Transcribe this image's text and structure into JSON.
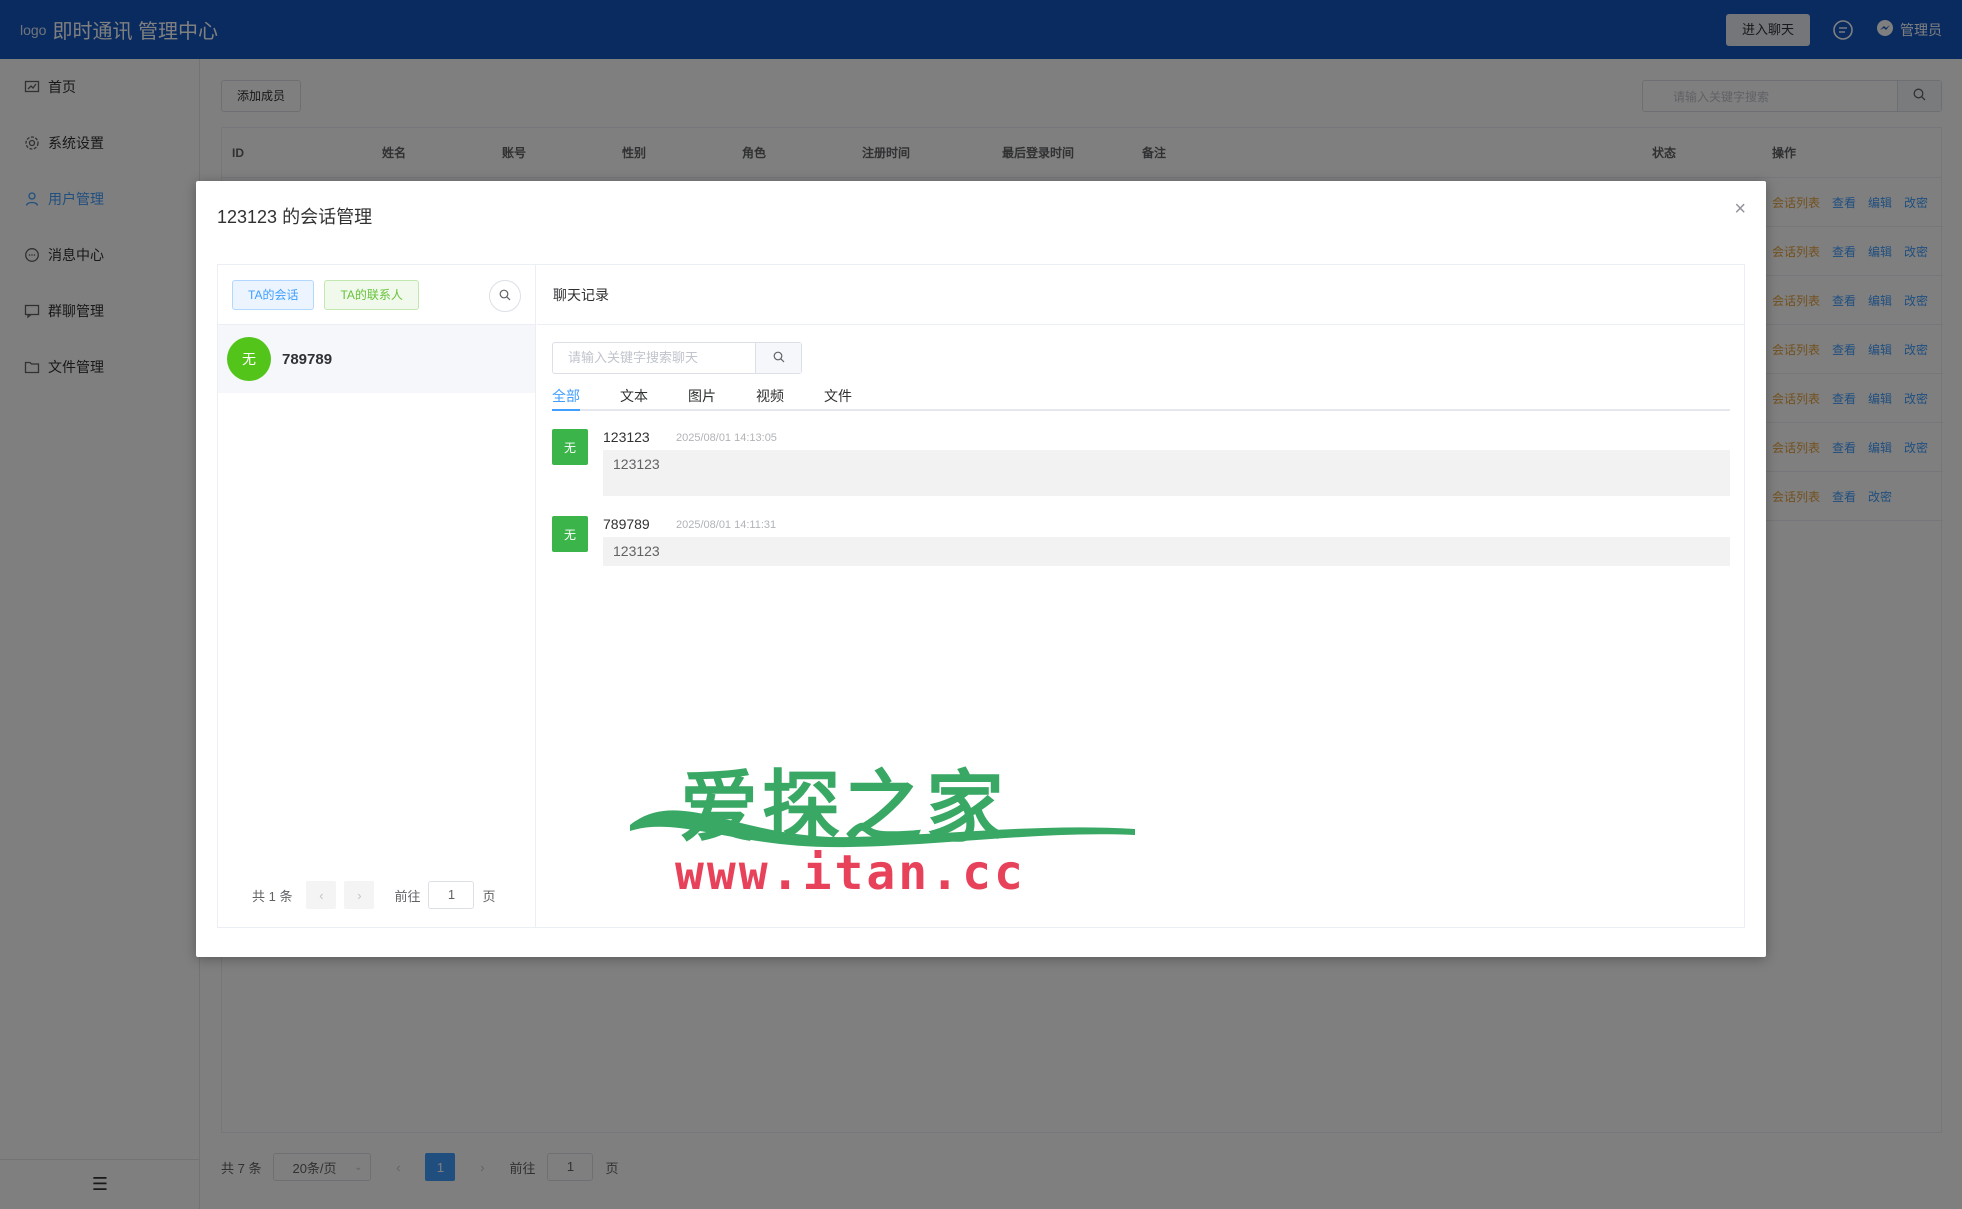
{
  "header": {
    "logo_alt": "logo",
    "title": "即时通讯 管理中心",
    "enter_chat_label": "进入聊天",
    "admin_name": "管理员"
  },
  "sidebar": {
    "items": [
      {
        "label": "首页",
        "icon": "chart-icon"
      },
      {
        "label": "系统设置",
        "icon": "gear-icon"
      },
      {
        "label": "用户管理",
        "icon": "user-icon"
      },
      {
        "label": "消息中心",
        "icon": "message-icon"
      },
      {
        "label": "群聊管理",
        "icon": "group-chat-icon"
      },
      {
        "label": "文件管理",
        "icon": "folder-icon"
      }
    ],
    "active_index": 2
  },
  "main": {
    "add_member_label": "添加成员",
    "search_placeholder": "请输入关键字搜索",
    "columns": [
      "ID",
      "姓名",
      "账号",
      "性别",
      "角色",
      "注册时间",
      "最后登录时间",
      "备注",
      "状态",
      "操作"
    ],
    "row_ops": [
      [
        "会话列表",
        "查看",
        "编辑",
        "改密"
      ],
      [
        "会话列表",
        "查看",
        "编辑",
        "改密"
      ],
      [
        "会话列表",
        "查看",
        "编辑",
        "改密"
      ],
      [
        "会话列表",
        "查看",
        "编辑",
        "改密"
      ],
      [
        "会话列表",
        "查看",
        "编辑",
        "改密"
      ],
      [
        "会话列表",
        "查看",
        "编辑",
        "改密"
      ],
      [
        "会话列表",
        "查看",
        "改密"
      ]
    ],
    "pager": {
      "total": "共 7 条",
      "page_size": "20条/页",
      "current_page": "1",
      "goto_prefix": "前往",
      "goto_value": "1",
      "goto_suffix": "页"
    }
  },
  "dialog": {
    "title": "123123 的会话管理",
    "close": "×",
    "tab_sessions": "TA的会话",
    "tab_contacts": "TA的联系人",
    "conversation": {
      "avatar_text": "无",
      "name": "789789"
    },
    "left_pager": {
      "total": "共 1 条",
      "goto_prefix": "前往",
      "goto_value": "1",
      "goto_suffix": "页"
    },
    "chat_header": "聊天记录",
    "chat_search_placeholder": "请输入关键字搜索聊天",
    "filter_tabs": [
      "全部",
      "文本",
      "图片",
      "视频",
      "文件"
    ],
    "active_filter": 0,
    "messages": [
      {
        "avatar_text": "无",
        "sender": "123123",
        "time": "2025/08/01 14:13:05",
        "content": "123123"
      },
      {
        "avatar_text": "无",
        "sender": "789789",
        "time": "2025/08/01 14:11:31",
        "content": "123123"
      }
    ]
  },
  "watermark": {
    "title": "爱探之家",
    "url": "www.itan.cc"
  },
  "colors": {
    "header_bg": "#1557c0",
    "accent": "#409eff",
    "warning": "#e6a23c",
    "success": "#67c23a"
  }
}
